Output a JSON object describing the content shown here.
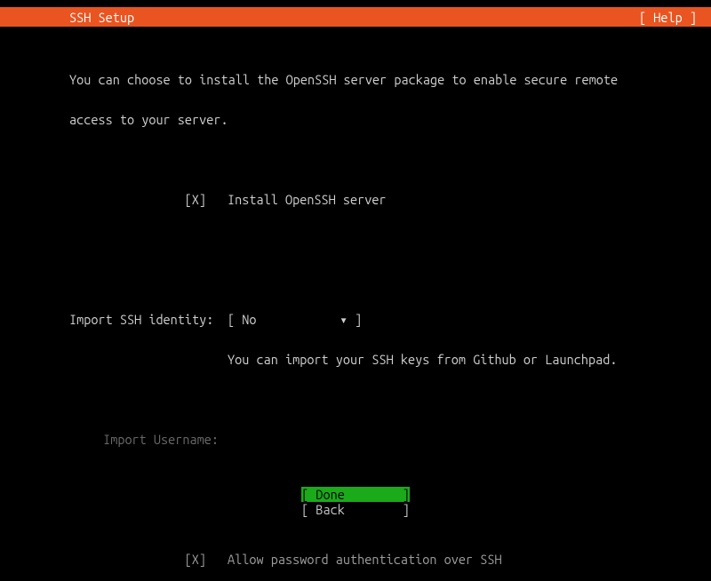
{
  "header": {
    "title": "SSH Setup",
    "help": "[ Help ]"
  },
  "description": {
    "line1": "You can choose to install the OpenSSH server package to enable secure remote",
    "line2": "access to your server."
  },
  "install": {
    "checkbox": "[X]",
    "label": "Install OpenSSH server"
  },
  "import_identity": {
    "label": "Import SSH identity:",
    "dropdown_open": "[ ",
    "dropdown_value": "No",
    "dropdown_arrow": "▾",
    "dropdown_close": " ]",
    "hint": "You can import your SSH keys from Github or Launchpad."
  },
  "import_username": {
    "label": "Import Username:"
  },
  "allow_password": {
    "checkbox": "[X]",
    "label": "Allow password authentication over SSH"
  },
  "footer": {
    "done": "[ Done        ]",
    "back": "[ Back        ]"
  }
}
